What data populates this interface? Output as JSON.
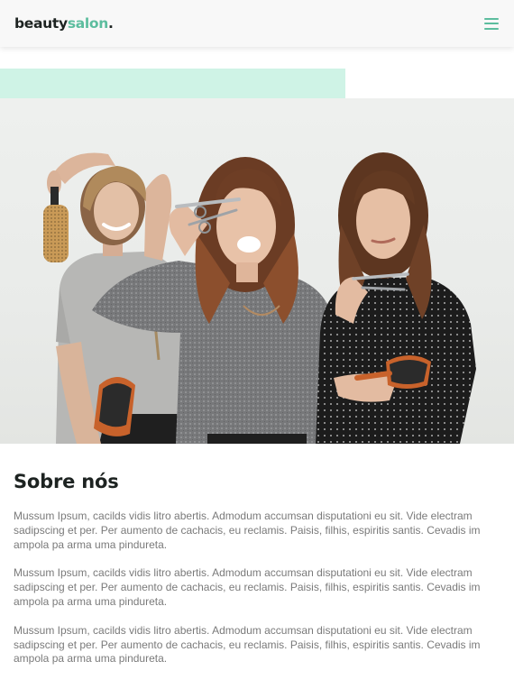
{
  "navbar": {
    "brand_primary": "beauty",
    "brand_accent": "salon",
    "brand_dot": ".",
    "menu_icon": "hamburger-menu-icon"
  },
  "hero": {
    "image_subject": "three-smiling-hairstylists-with-scissors-and-brushes"
  },
  "about": {
    "title": "Sobre nós",
    "paragraphs": [
      "Mussum Ipsum, cacilds vidis litro abertis. Admodum accumsan disputationi eu sit. Vide electram sadipscing et per. Per aumento de cachacis, eu reclamis. Paisis, filhis, espiritis santis. Cevadis im ampola pa arma uma pindureta.",
      "Mussum Ipsum, cacilds vidis litro abertis. Admodum accumsan disputationi eu sit. Vide electram sadipscing et per. Per aumento de cachacis, eu reclamis. Paisis, filhis, espiritis santis. Cevadis im ampola pa arma uma pindureta.",
      "Mussum Ipsum, cacilds vidis litro abertis. Admodum accumsan disputationi eu sit. Vide electram sadipscing et per. Per aumento de cachacis, eu reclamis. Paisis, filhis, espiritis santis. Cevadis im ampola pa arma uma pindureta."
    ]
  },
  "colors": {
    "accent": "#5cbd9e",
    "mint_block": "#cff3e6",
    "heading": "#1d2321",
    "body_text": "#7a7a7a"
  }
}
